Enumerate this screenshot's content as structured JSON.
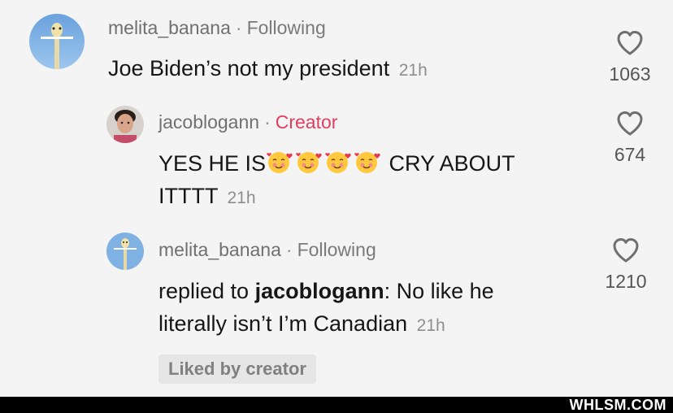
{
  "comments": [
    {
      "username": "melita_banana",
      "separator": "·",
      "tag": "Following",
      "text": "Joe Biden’s not my president",
      "time": "21h",
      "likes": "1063",
      "heart_icon": "heart-outline-icon"
    },
    {
      "username": "jacoblogann",
      "separator": "·",
      "tag": "Creator",
      "text_before": "YES HE IS",
      "emoji_icon": "smiling-face-with-hearts-icon",
      "text_after": " CRY ABOUT",
      "text_line2": "ITTTT",
      "time": "21h",
      "likes": "674",
      "heart_icon": "heart-outline-icon"
    },
    {
      "username": "melita_banana",
      "separator": "·",
      "tag": "Following",
      "replied_prefix": "replied to ",
      "replied_user": "jacoblogann",
      "text_rest": ": No like he",
      "text_line2": "literally isn’t I’m Canadian",
      "time": "21h",
      "likes": "1210",
      "heart_icon": "heart-outline-icon",
      "liked_by": "Liked by creator"
    }
  ],
  "colors": {
    "creator_tag": "#e0405e",
    "background": "#f4f4f4",
    "footer": "#000000"
  },
  "watermark": "WHLSM.COM"
}
